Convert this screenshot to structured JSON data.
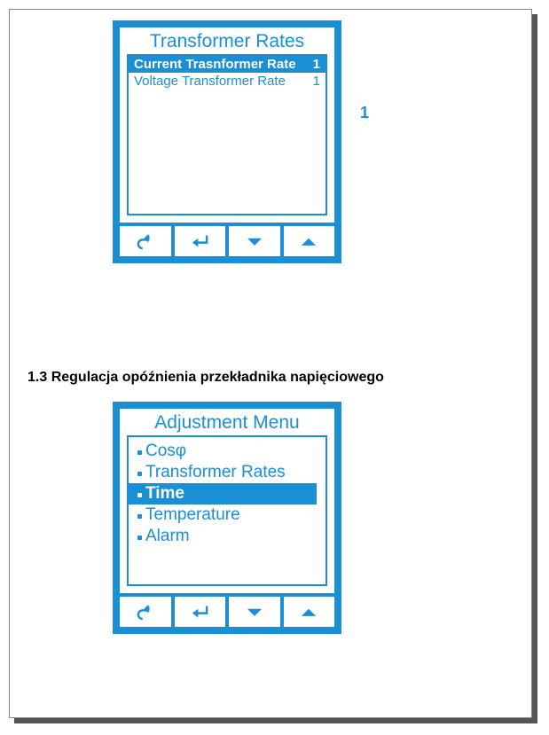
{
  "sideNumber": "1",
  "screen1": {
    "title": "Transformer Rates",
    "rows": [
      {
        "label": "Current Trasnformer Rate",
        "value": "1",
        "selected": true
      },
      {
        "label": "Voltage Transformer Rate",
        "value": "1",
        "selected": false
      }
    ]
  },
  "sectionHeading": "1.3 Regulacja opóźnienia przekładnika napięciowego",
  "screen2": {
    "title": "Adjustment Menu",
    "items": [
      {
        "label": "Cosφ",
        "selected": false
      },
      {
        "label": "Transformer Rates",
        "selected": false
      },
      {
        "label": "Time",
        "selected": true
      },
      {
        "label": "Temperature",
        "selected": false
      },
      {
        "label": "Alarm",
        "selected": false
      }
    ]
  },
  "buttons": {
    "back": "back-icon",
    "enter": "enter-icon",
    "down": "down-icon",
    "up": "up-icon"
  }
}
